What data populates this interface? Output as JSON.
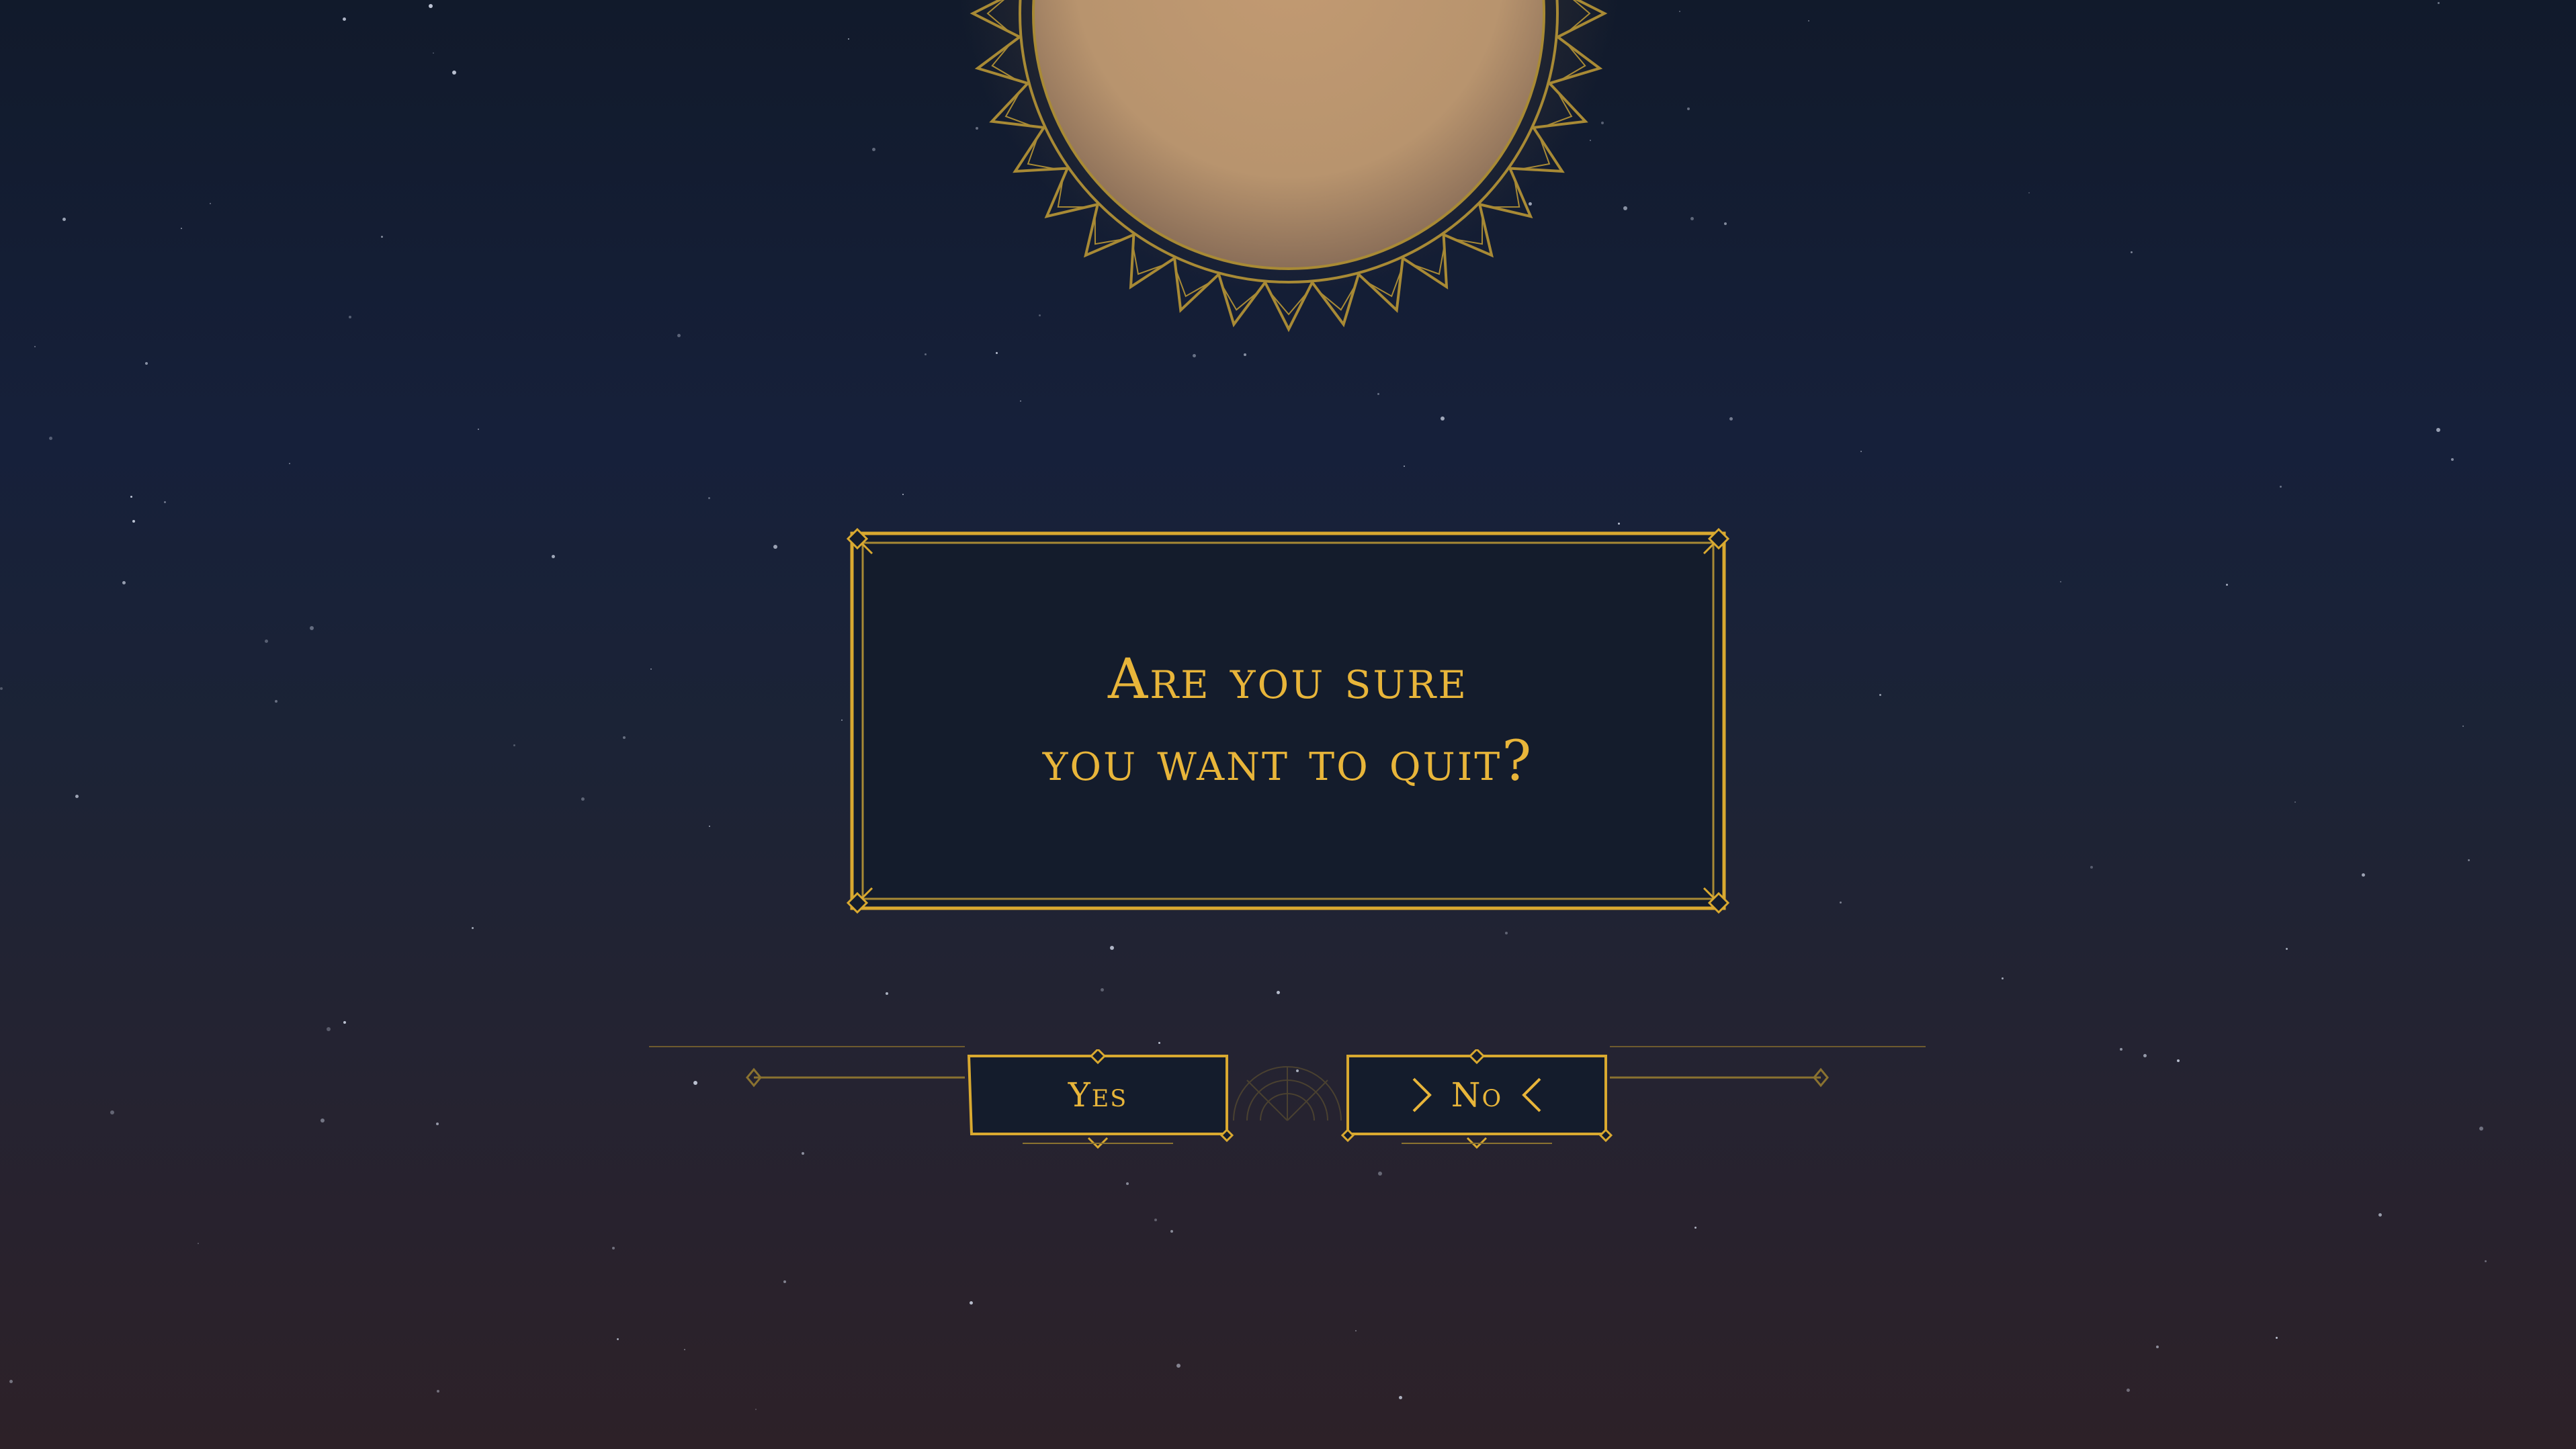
{
  "dialog": {
    "line1": "Are you sure",
    "line2": "you want to quit?"
  },
  "buttons": {
    "yes_label": "Yes",
    "no_label": "No",
    "selected": "No"
  },
  "colors": {
    "accent_gold": "#e8b53a",
    "panel_bg": "#141c2c",
    "sky_top": "#111a2b",
    "sky_bottom": "#2d2128",
    "sun": "#b8946e"
  },
  "icons": {
    "decor_sun": "sun-emblem-icon",
    "chevron_right": "chevron-right-icon",
    "chevron_left": "chevron-left-icon"
  }
}
